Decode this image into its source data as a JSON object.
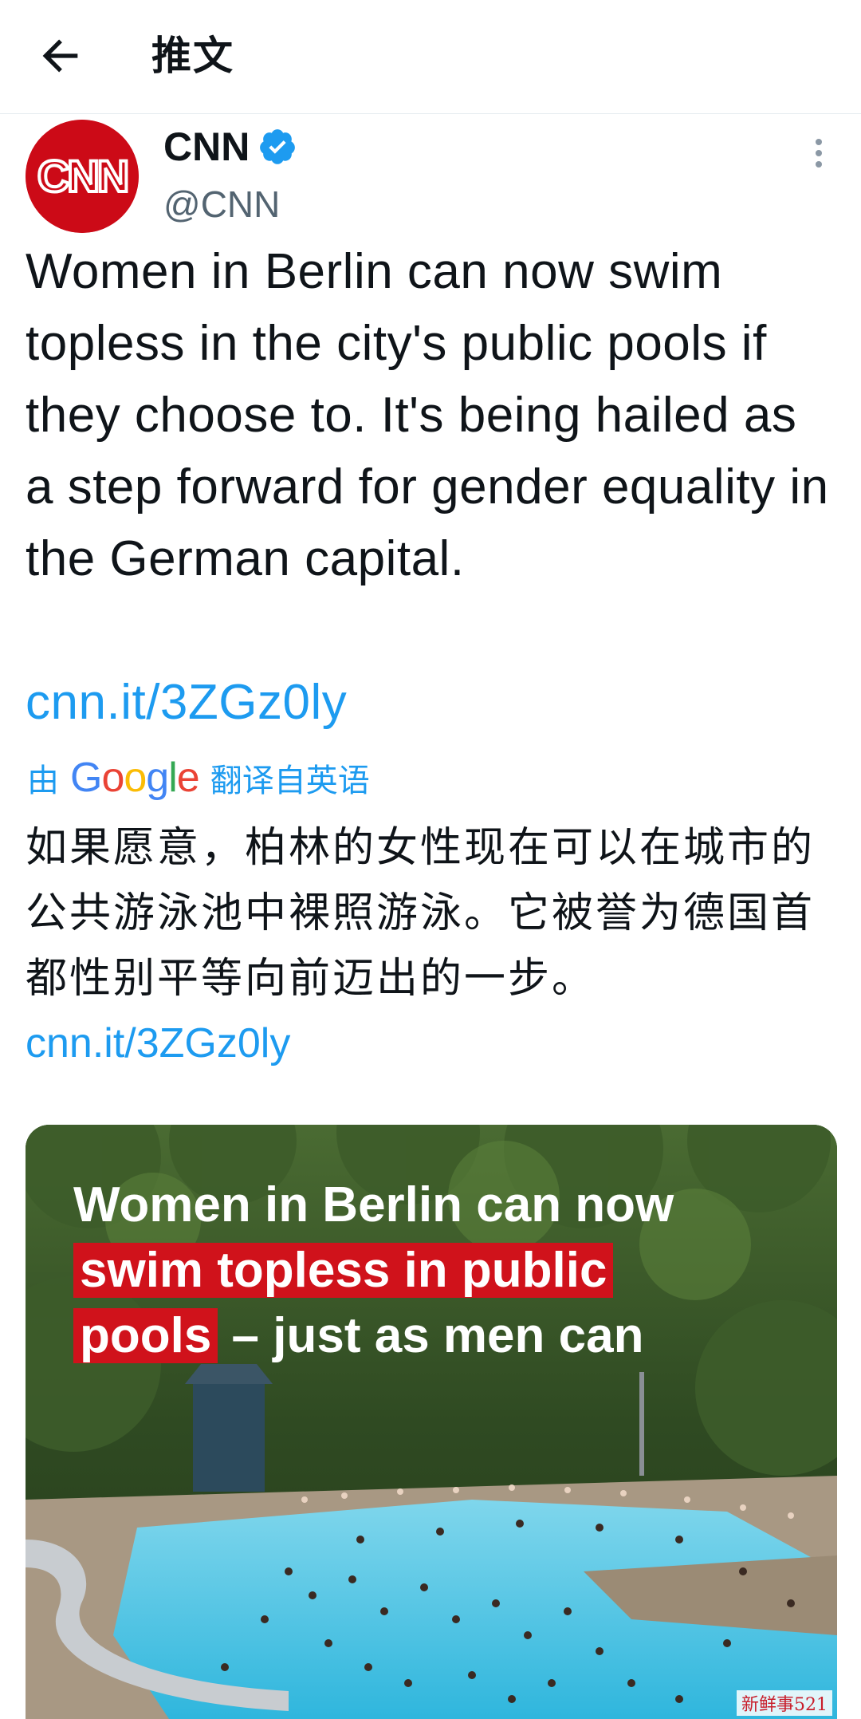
{
  "header": {
    "title": "推文",
    "back_icon": "arrow-left-icon"
  },
  "tweet": {
    "author_name": "CNN",
    "author_handle": "@CNN",
    "avatar_logo": "CNN",
    "verified_icon": "verified-badge-icon",
    "more_icon": "more-vertical-icon",
    "text": "Women in Berlin can now swim topless in the city's public pools if they choose to. It's being hailed as a step forward for gender equality in the German capital.",
    "link": "cnn.it/3ZGz0ly"
  },
  "translation": {
    "prefix": "由",
    "provider": "Google",
    "suffix": "翻译自英语",
    "text": "如果愿意，柏林的女性现在可以在城市的公共游泳池中裸照游泳。它被誉为德国首都性别平等向前迈出的一步。",
    "link": "cnn.it/3ZGz0ly"
  },
  "media": {
    "headline_line1": "Women in Berlin can now",
    "headline_line2": "swim topless in public",
    "headline_line3_highlight": "pools",
    "headline_line3_rest": " – just as men can",
    "watermark": "新鲜事521"
  },
  "colors": {
    "link": "#1d9bf0",
    "cnn_red": "#cc0a17",
    "highlight_red": "#d0121b"
  }
}
